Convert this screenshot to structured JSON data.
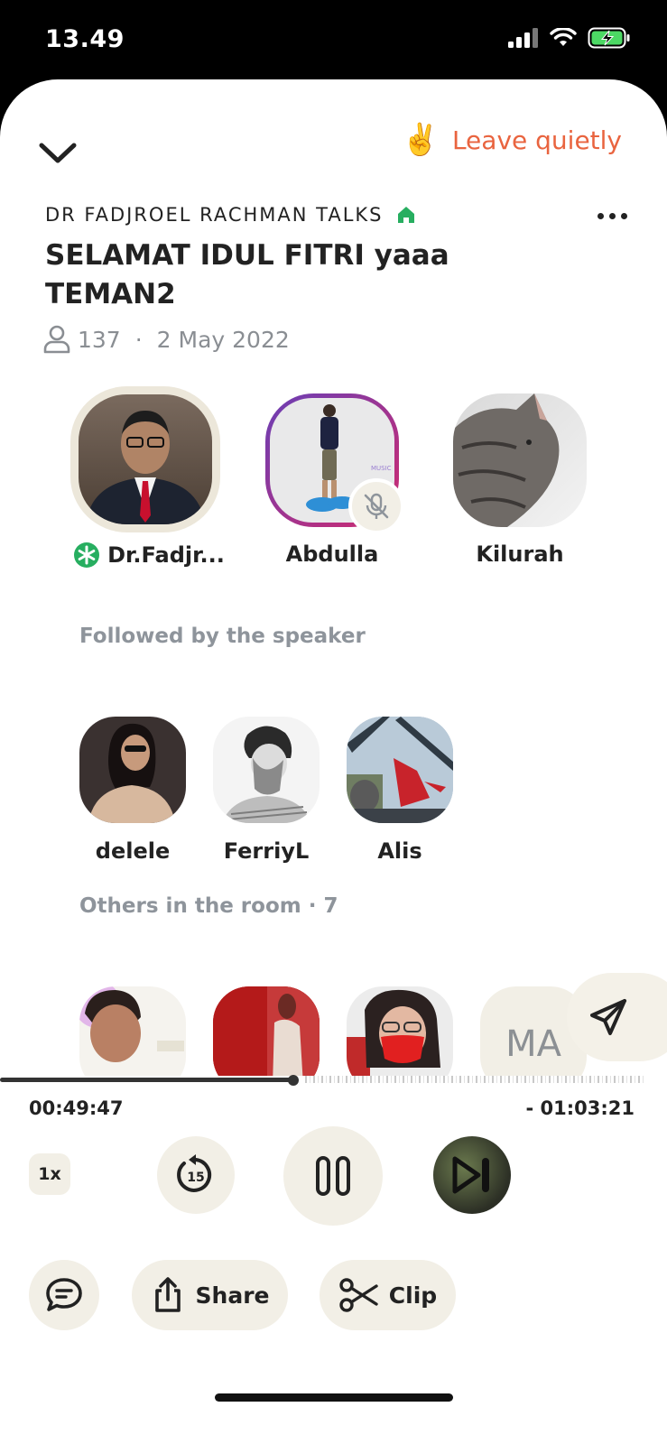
{
  "status_bar": {
    "time": "13.49"
  },
  "header": {
    "leave_emoji": "✌️",
    "leave_label": "Leave quietly"
  },
  "club": {
    "name": "DR FADJROEL RACHMAN TALKS"
  },
  "room": {
    "title": "SELAMAT IDUL FITRI yaaa TEMAN2",
    "listener_count": "137",
    "date": "2 May 2022"
  },
  "speakers": [
    {
      "name": "Dr.Fadjr...",
      "moderator": true
    },
    {
      "name": "Abdulla",
      "muted": true
    },
    {
      "name": "Kilurah"
    }
  ],
  "followed_section": {
    "label": "Followed by the speaker"
  },
  "followed": [
    {
      "name": "delele"
    },
    {
      "name": "FerriyL"
    },
    {
      "name": "Alis"
    }
  ],
  "others_section": {
    "label": "Others in the room · 7"
  },
  "others": [
    {
      "initials": ""
    },
    {
      "initials": ""
    },
    {
      "initials": ""
    },
    {
      "initials": "MA"
    }
  ],
  "player": {
    "elapsed": "00:49:47",
    "remaining": "- 01:03:21",
    "speed": "1x",
    "skip_seconds": "15",
    "progress_fraction": 0.44
  },
  "actions": {
    "share_label": "Share",
    "clip_label": "Clip"
  },
  "colors": {
    "accent_orange": "#e9643f",
    "club_green": "#27ae60",
    "button_bg": "#f2efe6"
  }
}
